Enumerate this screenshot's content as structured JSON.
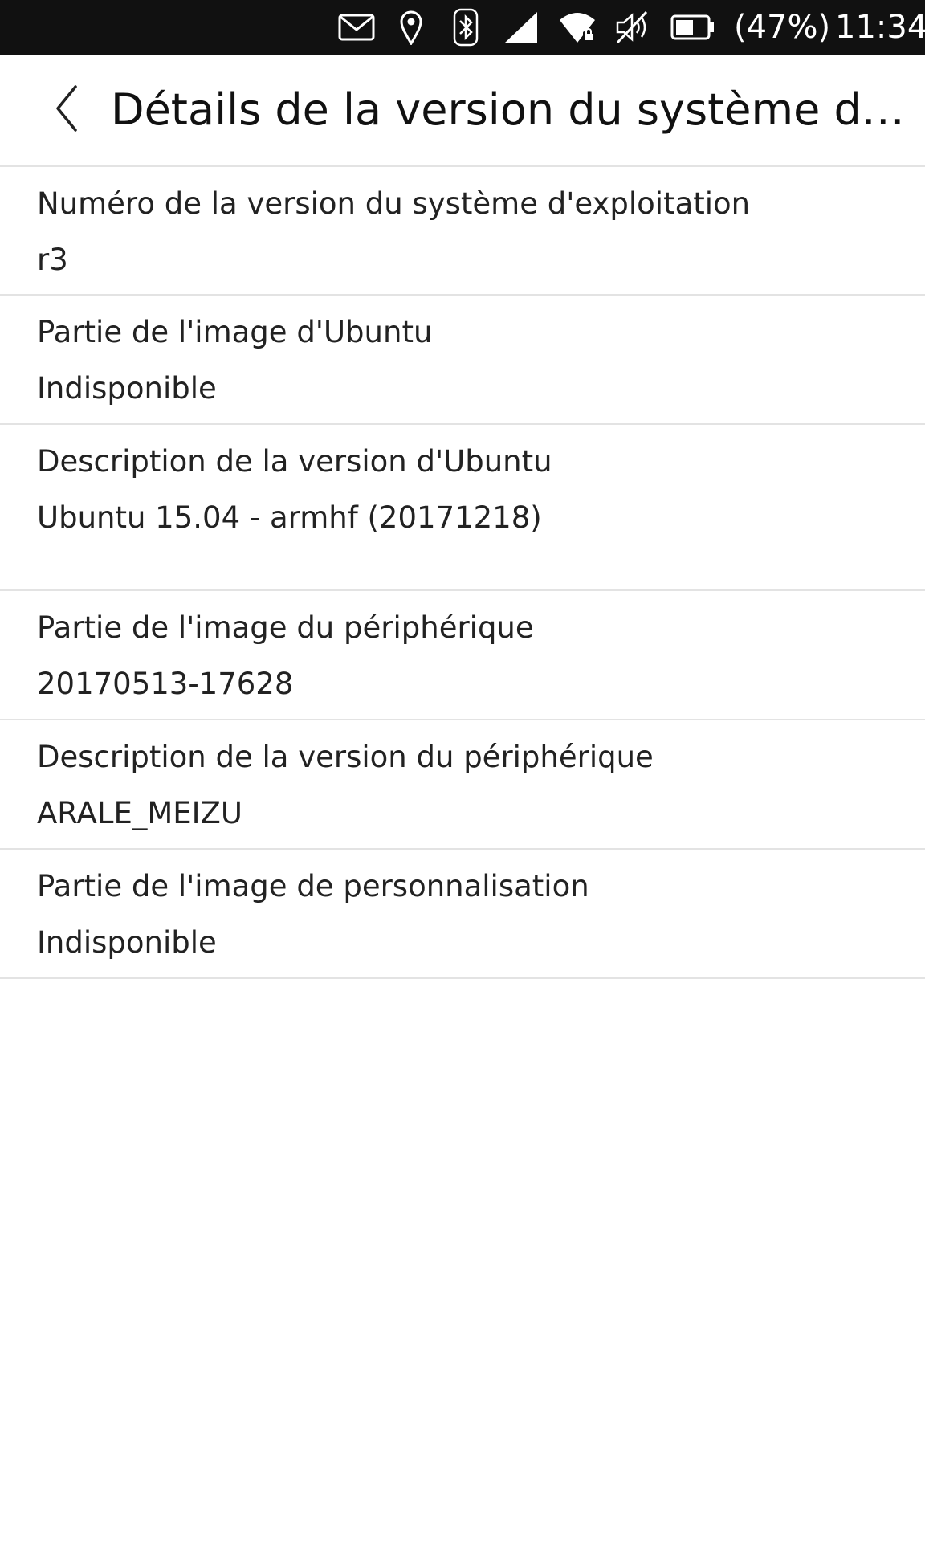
{
  "status_bar": {
    "icons": [
      "mail-icon",
      "location-icon",
      "bluetooth-icon",
      "cellular-signal-icon",
      "wifi-icon",
      "volume-muted-icon",
      "battery-icon"
    ],
    "battery_percent": "(47%)",
    "time": "11:34"
  },
  "header": {
    "back_icon": "chevron-left-icon",
    "title": "Détails de la version du système d'exploitation"
  },
  "items": [
    {
      "label": "Numéro de la version du système d'exploitation",
      "value": "r3"
    },
    {
      "label": "Partie de l'image d'Ubuntu",
      "value": "Indisponible"
    },
    {
      "label": "Description de la version d'Ubuntu",
      "value": "Ubuntu 15.04 - armhf (20171218)"
    },
    {
      "label": "Partie de l'image du périphérique",
      "value": "20170513-17628"
    },
    {
      "label": "Description de la version du périphérique",
      "value": "ARALE_MEIZU"
    },
    {
      "label": "Partie de l'image de personnalisation",
      "value": "Indisponible"
    }
  ]
}
